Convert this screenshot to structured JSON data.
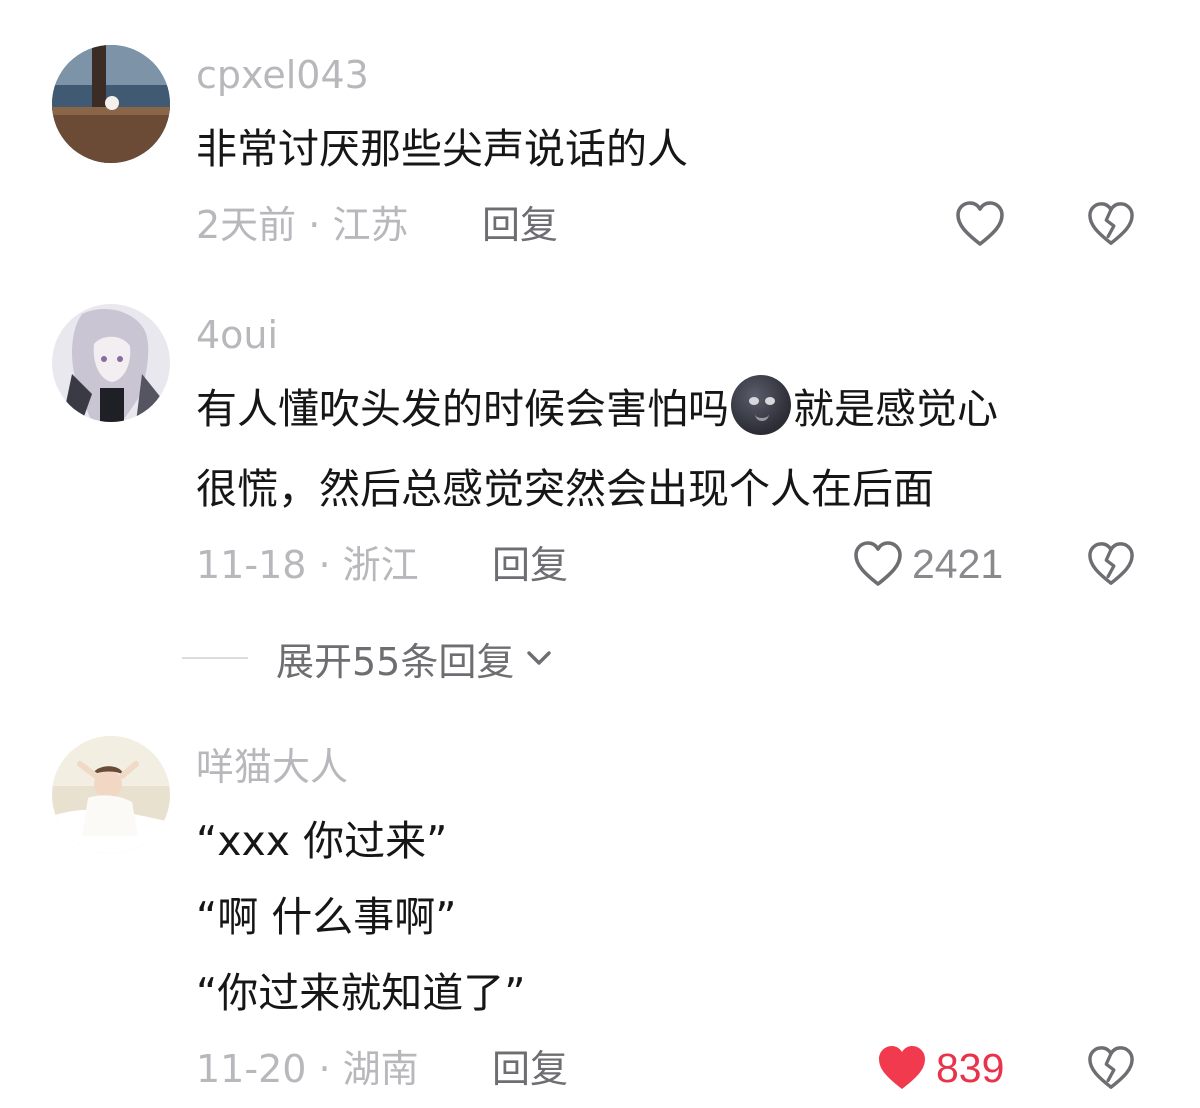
{
  "comments": [
    {
      "username": "cpxel043",
      "lines": [
        "非常讨厌那些尖声说话的人"
      ],
      "date": "2天前",
      "location": "江苏",
      "reply_label": "回复",
      "likes": "",
      "liked": false
    },
    {
      "username": "4oui",
      "lines_before_emoji": "有人懂吹头发的时候会害怕吗",
      "emoji": "new-moon-face",
      "lines_after_emoji": "就是感觉心",
      "line2": "很慌，然后总感觉突然会出现个人在后面",
      "date": "11-18",
      "location": "浙江",
      "reply_label": "回复",
      "likes": "2421",
      "liked": false
    },
    {
      "username": "咩猫大人",
      "lines": [
        "“xxx 你过来”",
        "“啊 什么事啊”",
        "“你过来就知道了”"
      ],
      "date": "11-20",
      "location": "湖南",
      "reply_label": "回复",
      "likes": "839",
      "liked": true
    }
  ],
  "expand_replies": {
    "label": "展开55条回复"
  },
  "meta_separator": " · ",
  "icons": {
    "like": "heart-outline-icon",
    "liked": "heart-filled-icon",
    "dislike": "broken-heart-icon",
    "expand": "chevron-down-icon"
  },
  "colors": {
    "liked": "#f23a4f",
    "muted": "#b8b8bc",
    "text": "#161616"
  }
}
